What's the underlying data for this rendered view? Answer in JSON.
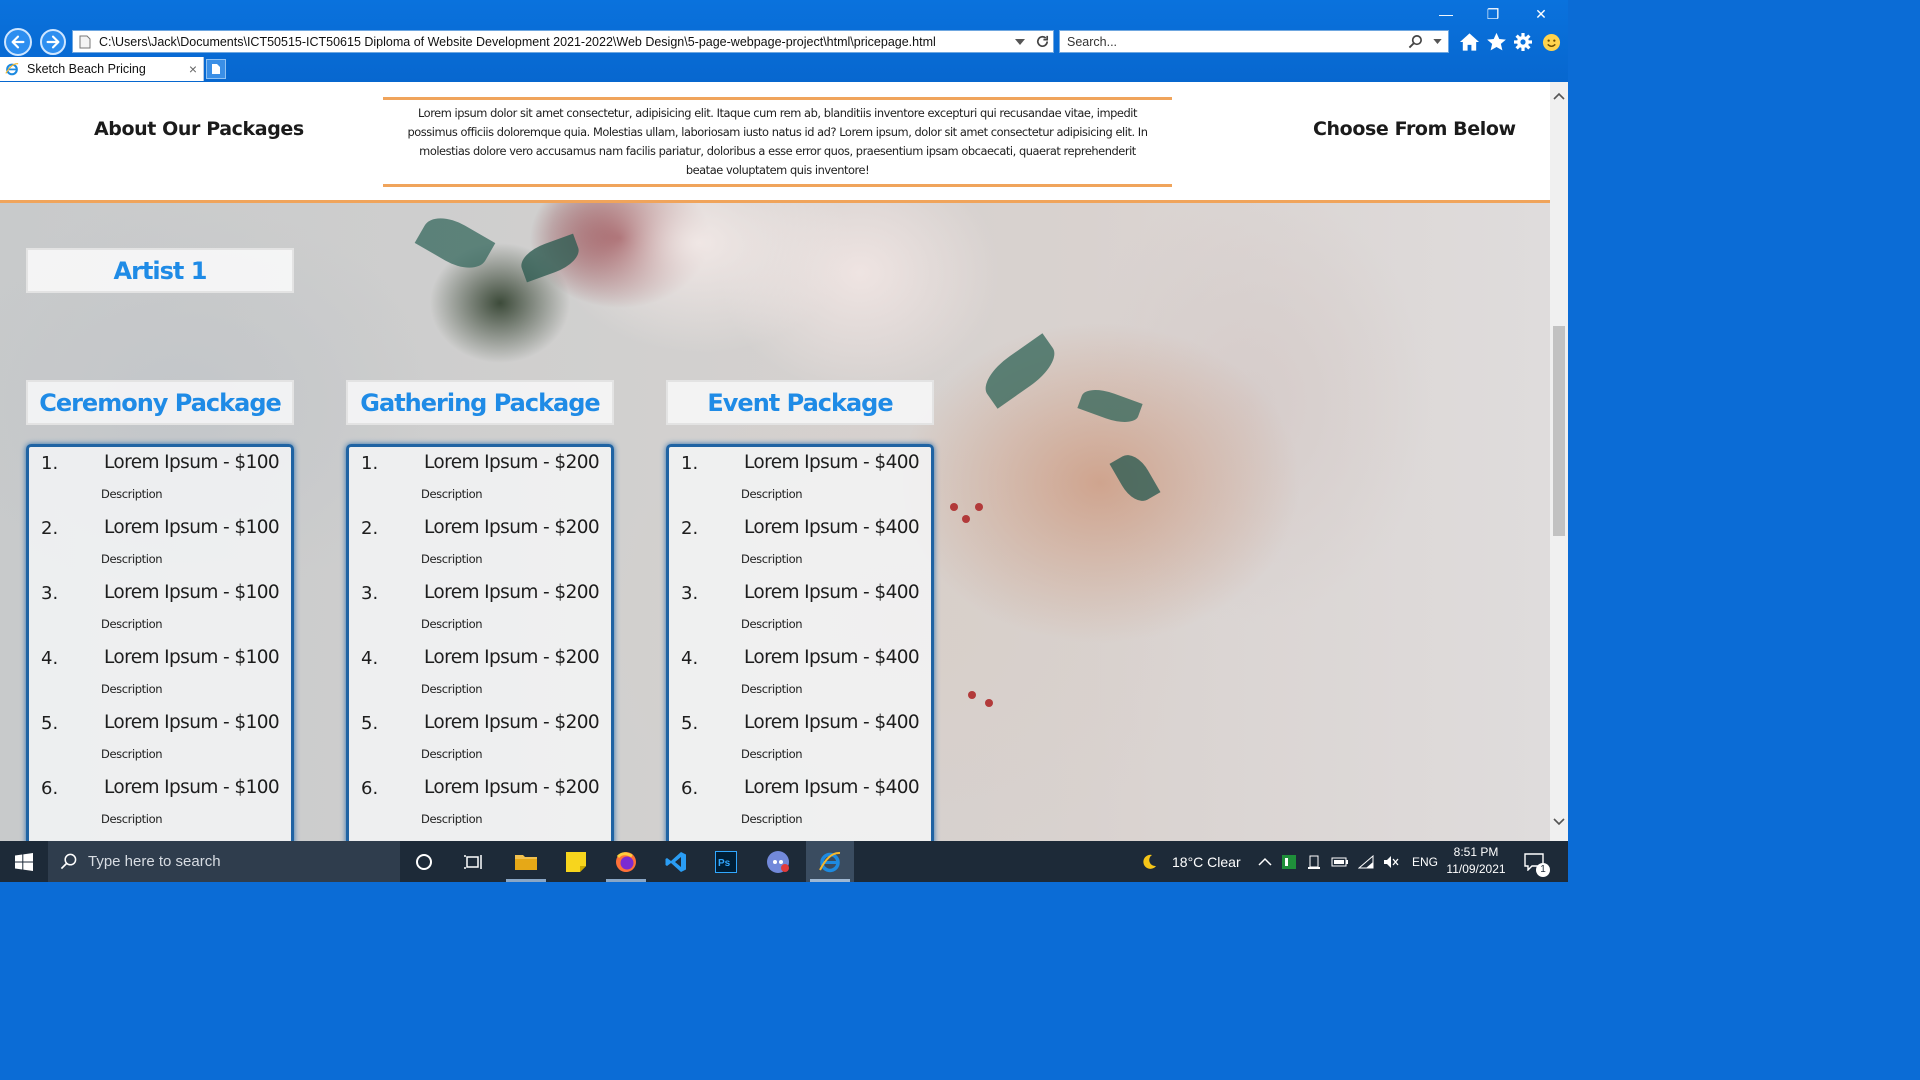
{
  "browser": {
    "address_url": "C:\\Users\\Jack\\Documents\\ICT50515-ICT50615 Diploma of Website Development 2021-2022\\Web Design\\5-page-webpage-project\\html\\pricepage.html",
    "search_placeholder": "Search...",
    "tab_title": "Sketch Beach Pricing",
    "tab_close": "×",
    "window_controls": {
      "minimize": "—",
      "restore": "❐",
      "close": "✕"
    }
  },
  "page": {
    "header": {
      "left_heading": "About Our Packages",
      "right_heading": "Choose From Below",
      "intro_text": "Lorem ipsum dolor sit amet consectetur, adipisicing elit. Itaque cum rem ab, blanditiis inventore excepturi qui recusandae vitae, impedit possimus officiis doloremque quia. Molestias ullam, laboriosam iusto natus id ad? Lorem ipsum, dolor sit amet consectetur adipisicing elit. In molestias dolore vero accusamus nam facilis pariatur, doloribus a esse error quos, praesentium ipsam obcaecati, quaerat reprehenderit beatae voluptatem quis inventore!"
    },
    "artist_title": "Artist 1",
    "packages": [
      {
        "title": "Ceremony Package",
        "items": [
          {
            "num": "1.",
            "name": "Lorem Ipsum - $100",
            "desc": "Description"
          },
          {
            "num": "2.",
            "name": "Lorem Ipsum - $100",
            "desc": "Description"
          },
          {
            "num": "3.",
            "name": "Lorem Ipsum - $100",
            "desc": "Description"
          },
          {
            "num": "4.",
            "name": "Lorem Ipsum - $100",
            "desc": "Description"
          },
          {
            "num": "5.",
            "name": "Lorem Ipsum - $100",
            "desc": "Description"
          },
          {
            "num": "6.",
            "name": "Lorem Ipsum - $100",
            "desc": "Description"
          }
        ]
      },
      {
        "title": "Gathering Package",
        "items": [
          {
            "num": "1.",
            "name": "Lorem Ipsum - $200",
            "desc": "Description"
          },
          {
            "num": "2.",
            "name": "Lorem Ipsum - $200",
            "desc": "Description"
          },
          {
            "num": "3.",
            "name": "Lorem Ipsum - $200",
            "desc": "Description"
          },
          {
            "num": "4.",
            "name": "Lorem Ipsum - $200",
            "desc": "Description"
          },
          {
            "num": "5.",
            "name": "Lorem Ipsum - $200",
            "desc": "Description"
          },
          {
            "num": "6.",
            "name": "Lorem Ipsum - $200",
            "desc": "Description"
          }
        ]
      },
      {
        "title": "Event Package",
        "items": [
          {
            "num": "1.",
            "name": "Lorem Ipsum - $400",
            "desc": "Description"
          },
          {
            "num": "2.",
            "name": "Lorem Ipsum - $400",
            "desc": "Description"
          },
          {
            "num": "3.",
            "name": "Lorem Ipsum - $400",
            "desc": "Description"
          },
          {
            "num": "4.",
            "name": "Lorem Ipsum - $400",
            "desc": "Description"
          },
          {
            "num": "5.",
            "name": "Lorem Ipsum - $400",
            "desc": "Description"
          },
          {
            "num": "6.",
            "name": "Lorem Ipsum - $400",
            "desc": "Description"
          }
        ]
      }
    ]
  },
  "taskbar": {
    "search_placeholder": "Type here to search",
    "weather": "18°C  Clear",
    "language": "ENG",
    "time": "8:51 PM",
    "date": "11/09/2021",
    "notification_count": "1"
  },
  "icons": {
    "back": "back-arrow-icon",
    "forward": "forward-arrow-icon",
    "home": "home-icon",
    "favorites": "star-icon",
    "settings": "gear-icon",
    "feedback": "smiley-icon"
  },
  "colors": {
    "accent_orange": "#f0a45b",
    "title_blue": "#1f8be6",
    "list_border": "#1f63a3",
    "chrome_blue": "#0a72dd"
  }
}
